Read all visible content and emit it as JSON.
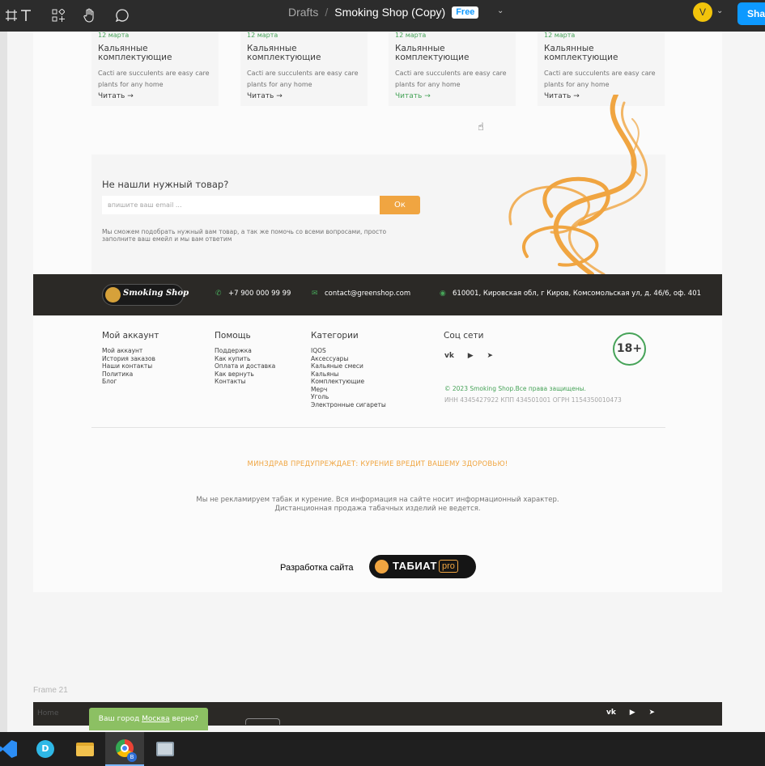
{
  "toolbar": {
    "breadcrumb_root": "Drafts",
    "file_name": "Smoking Shop (Copy)",
    "plan_badge": "Free",
    "avatar_initial": "V",
    "share_label": "Share",
    "icons": [
      "text-tool-icon",
      "components-icon",
      "hand-tool-icon",
      "comment-icon"
    ]
  },
  "cards": [
    {
      "date": "12 марта",
      "title": "Кальянные комплектующие",
      "desc": "Cacti are succulents are easy care plants for any home",
      "read": "Читать",
      "active": false
    },
    {
      "date": "12 марта",
      "title": "Кальянные комплектующие",
      "desc": "Cacti are succulents are easy care plants for any home",
      "read": "Читать",
      "active": false
    },
    {
      "date": "12 марта",
      "title": "Кальянные комплектующие",
      "desc": "Cacti are succulents are easy care plants for any home",
      "read": "Читать",
      "active": true
    },
    {
      "date": "12 марта",
      "title": "Кальянные комплектующие",
      "desc": "Cacti are succulents are easy care plants for any home",
      "read": "Читать",
      "active": false
    }
  ],
  "newsletter": {
    "title": "Не нашли нужный товар?",
    "placeholder": "впишите ваш email ...",
    "button": "Ок",
    "description": "Мы сможем подобрать нужный вам товар, а так же помочь со всеми вопросами, просто заполните ваш емейл и мы вам ответим"
  },
  "contact_bar": {
    "logo_text": "Smoking Shop",
    "phone": "+7 900 000 99 99",
    "email": "contact@greenshop.com",
    "address": "610001, Кировская обл, г Киров, Комсомольская ул, д. 46/6, оф. 401"
  },
  "footer": {
    "account": {
      "title": "Мой аккаунт",
      "items": [
        "Мой аккаунт",
        "История заказов",
        "Наши контакты",
        "Политика",
        "Блог"
      ]
    },
    "help": {
      "title": "Помощь",
      "items": [
        "Поддержка",
        "Как купить",
        "Оплата и доставка",
        "Как вернуть",
        "Контакты"
      ]
    },
    "categories": {
      "title": "Категории",
      "items": [
        "IQOS",
        "Аксессуары",
        "Кальяные смеси",
        "Кальяны",
        "Комплектующие",
        "Мерч",
        "Уголь",
        "Электронные сигареты"
      ]
    },
    "social": {
      "title": "Соц сети",
      "icons": [
        "vk-icon",
        "youtube-icon",
        "telegram-icon"
      ]
    },
    "age_badge": "18+",
    "copyright": "© 2023 Smoking Shop.Все права защищены.",
    "requisites": "ИНН 4345427922 КПП 434501001 ОГРН 1154350010473",
    "warning": "МИНЗДРАВ ПРЕДУПРЕЖДАЕТ: КУРЕНИЕ ВРЕДИТ ВАШЕМУ ЗДОРОВЬЮ!",
    "disclaimer": "Мы не рекламируем табак и курение. Вся информация на сайте носит информационный характер. Дистанционная продажа табачных изделий не ведется.",
    "dev_label": "Разработка сайта",
    "dev_brand": "ТАБИАТ",
    "dev_brand_suffix": "pro"
  },
  "frame21": {
    "label": "Frame 21",
    "home_text": "Home",
    "city_popup_prefix": "Ваш город",
    "city_popup_city": "Москва",
    "city_popup_suffix": "верно?"
  },
  "colors": {
    "accent_orange": "#f0a541",
    "accent_green": "#46a358",
    "dark_bar": "#2b2926",
    "figma_blue": "#0d99ff"
  }
}
